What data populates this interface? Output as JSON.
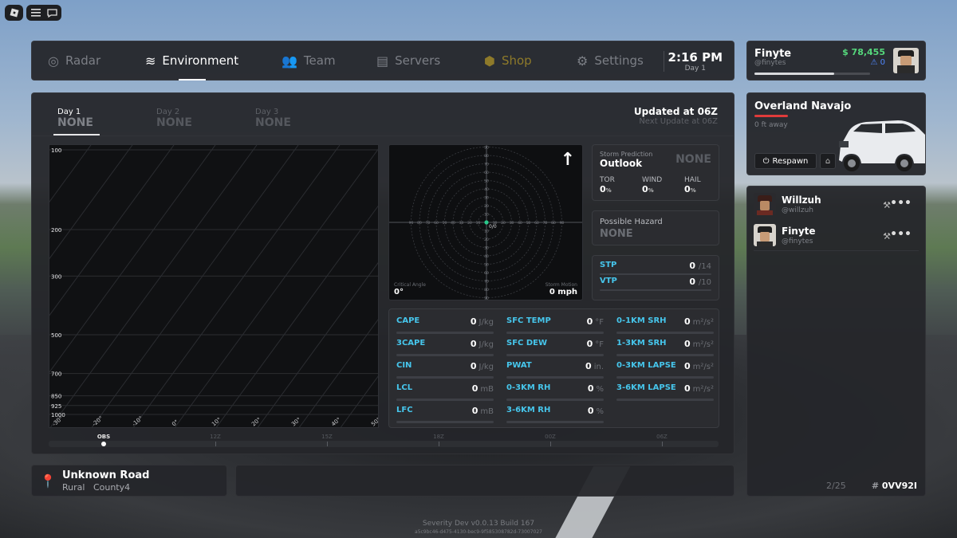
{
  "top_buttons": {
    "roblox": "roblox-icon",
    "menu": "menu-icon",
    "chat": "chat-icon"
  },
  "nav": {
    "items": [
      {
        "label": "Radar",
        "icon": "radar-icon"
      },
      {
        "label": "Environment",
        "icon": "wind-icon"
      },
      {
        "label": "Team",
        "icon": "team-icon"
      },
      {
        "label": "Servers",
        "icon": "servers-icon"
      },
      {
        "label": "Shop",
        "icon": "shop-icon"
      },
      {
        "label": "Settings",
        "icon": "gear-icon"
      }
    ],
    "time": "2:16 PM",
    "day": "Day 1"
  },
  "user": {
    "name": "Finyte",
    "handle": "@finytes",
    "money": "$ 78,455",
    "tix": "0",
    "progress": 0.69
  },
  "vehicle": {
    "name": "Overland Navajo",
    "distance": "0 ft away",
    "respawn": "Respawn"
  },
  "players": {
    "list": [
      {
        "name": "Willzuh",
        "handle": "@willzuh"
      },
      {
        "name": "Finyte",
        "handle": "@finytes"
      }
    ],
    "count": "2/25",
    "code_hash": "#",
    "code": "0VV92I"
  },
  "days": [
    {
      "label": "Day 1",
      "value": "NONE"
    },
    {
      "label": "Day 2",
      "value": "NONE"
    },
    {
      "label": "Day 3",
      "value": "NONE"
    }
  ],
  "updated": "Updated at 06Z",
  "next_update": "Next Update at 06Z",
  "skewt": {
    "pressure_levels": [
      "100",
      "200",
      "300",
      "500",
      "700",
      "850",
      "925",
      "1000"
    ],
    "temp_labels": [
      "-30°",
      "-20°",
      "-10°",
      "0°",
      "10°",
      "20°",
      "30°",
      "40°",
      "50°"
    ]
  },
  "hodograph": {
    "ring_labels": [
      "10",
      "20",
      "30",
      "40",
      "50",
      "60",
      "70",
      "80",
      "90"
    ],
    "center": "0/0",
    "critical_angle_label": "Critical Angle",
    "critical_angle": "0°",
    "storm_motion_label": "Storm Motion",
    "storm_motion": "0 mph"
  },
  "storm_prediction": {
    "label": "Storm Prediction",
    "title": "Outlook",
    "value": "NONE",
    "items": [
      {
        "k": "TOR",
        "v": "0",
        "u": "%"
      },
      {
        "k": "WIND",
        "v": "0",
        "u": "%"
      },
      {
        "k": "HAIL",
        "v": "0",
        "u": "%"
      }
    ]
  },
  "hazard": {
    "label": "Possible Hazard",
    "value": "NONE"
  },
  "indices": [
    {
      "k": "STP",
      "v": "0",
      "max": "/14"
    },
    {
      "k": "VTP",
      "v": "0",
      "max": "/10"
    }
  ],
  "params": [
    {
      "k": "CAPE",
      "v": "0",
      "u": "J/kg"
    },
    {
      "k": "3CAPE",
      "v": "0",
      "u": "J/kg"
    },
    {
      "k": "CIN",
      "v": "0",
      "u": "J/kg"
    },
    {
      "k": "LCL",
      "v": "0",
      "u": "mB"
    },
    {
      "k": "LFC",
      "v": "0",
      "u": "mB"
    },
    {
      "k": "SFC TEMP",
      "v": "0",
      "u": "°F"
    },
    {
      "k": "SFC DEW",
      "v": "0",
      "u": "°F"
    },
    {
      "k": "PWAT",
      "v": "0",
      "u": "in."
    },
    {
      "k": "0-3KM RH",
      "v": "0",
      "u": "%"
    },
    {
      "k": "3-6KM RH",
      "v": "0",
      "u": "%"
    },
    {
      "k": "0-1KM SRH",
      "v": "0",
      "u": "m²/s²"
    },
    {
      "k": "1-3KM SRH",
      "v": "0",
      "u": "m²/s²"
    },
    {
      "k": "0-3KM LAPSE",
      "v": "0",
      "u": "m²/s²"
    },
    {
      "k": "3-6KM LAPSE",
      "v": "0",
      "u": "m²/s²"
    }
  ],
  "timeline": [
    "OBS",
    "12Z",
    "15Z",
    "18Z",
    "00Z",
    "06Z"
  ],
  "location": {
    "road": "Unknown Road",
    "type": "Rural",
    "county": "County4"
  },
  "version": {
    "line1": "Severity Dev  v0.0.13    Build 167",
    "line2": "a5c9bc46-d475-4130-bec9-9f585308782d-73007027"
  }
}
